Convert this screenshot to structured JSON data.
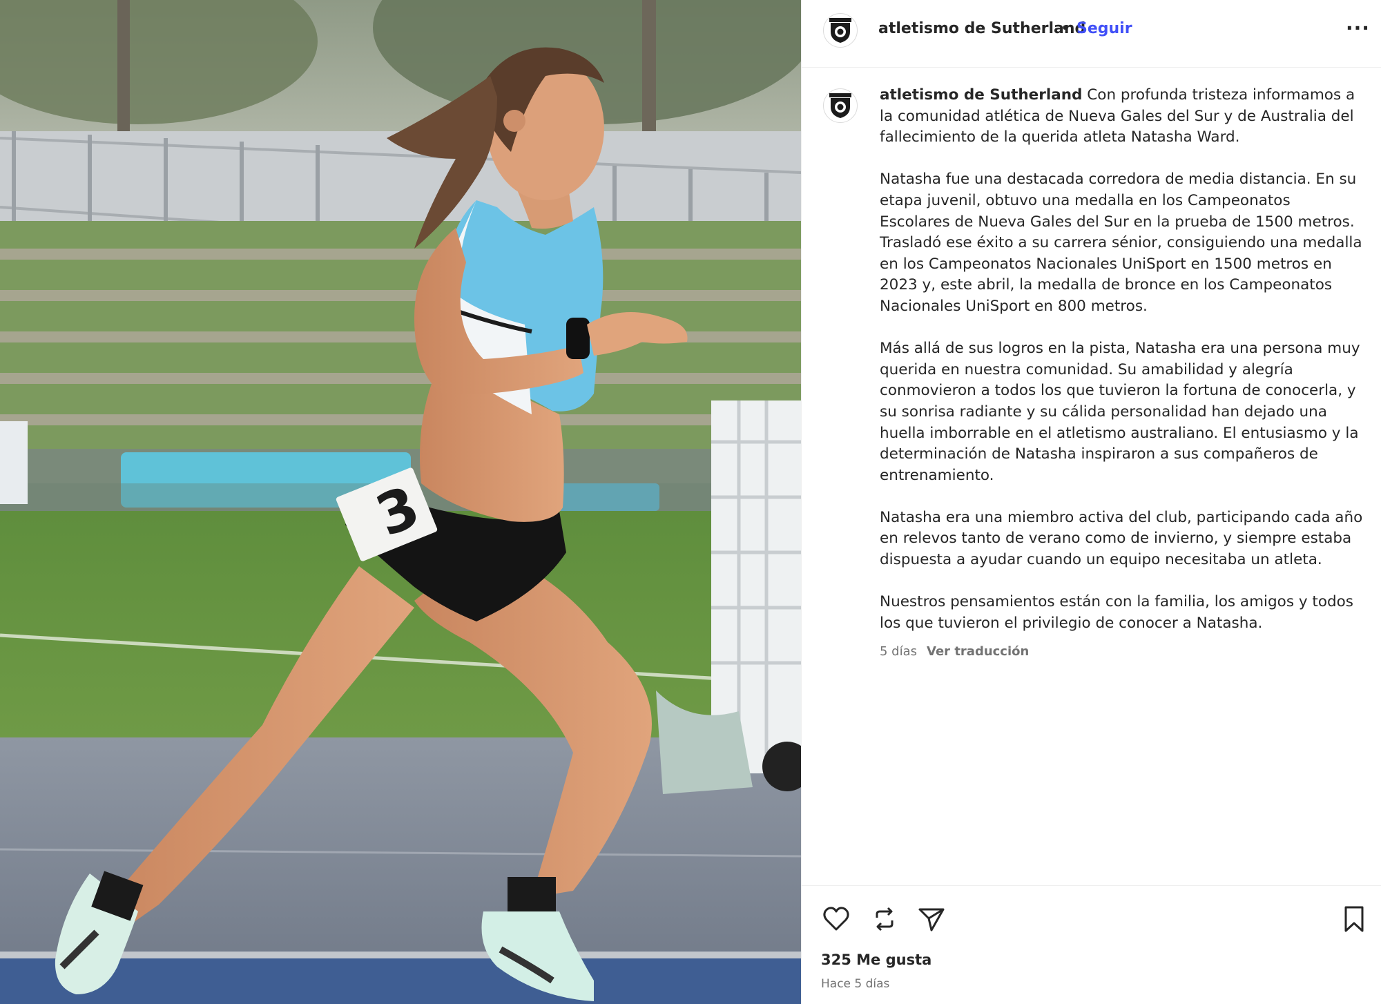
{
  "post": {
    "photo_alt": "Natasha Ward",
    "bib_number": "3"
  },
  "header": {
    "account_name": "atletismo de Sutherland",
    "separator": "•",
    "follow_label": "Seguir",
    "more_label": "···"
  },
  "caption": {
    "username": "atletismo de Sutherland",
    "paragraphs": [
      "Con profunda tristeza informamos a la comunidad atlética de Nueva Gales del Sur y de Australia del fallecimiento de la querida atleta Natasha Ward.",
      "Natasha fue una destacada corredora de media distancia. En su etapa juvenil, obtuvo una medalla en los Campeonatos Escolares de Nueva Gales del Sur en la prueba de 1500 metros. Trasladó ese éxito a su carrera sénior, consiguiendo una medalla en los Campeonatos Nacionales UniSport en 1500 metros en 2023 y, este abril, la medalla de bronce en los Campeonatos Nacionales UniSport en 800 metros.",
      "Más allá de sus logros en la pista, Natasha era una persona muy querida en nuestra comunidad. Su amabilidad y alegría conmovieron a todos los que tuvieron la fortuna de conocerla, y su sonrisa radiante y su cálida personalidad han dejado una huella imborrable en el atletismo australiano. El entusiasmo y la determinación de Natasha inspiraron a sus compañeros de entrenamiento.",
      "Natasha era una miembro activa del club, participando cada año en relevos tanto de verano como de invierno, y siempre estaba dispuesta a ayudar cuando un equipo necesitaba un atleta.",
      "Nuestros pensamientos están con la familia, los amigos y todos los que tuvieron el privilegio de conocer a Natasha."
    ],
    "age": "5 días",
    "translate_label": "Ver traducción"
  },
  "actions": {
    "icons": [
      "heart-icon",
      "repost-icon",
      "share-icon",
      "bookmark-icon"
    ],
    "likes_label": "325 Me gusta",
    "posted_label": "Hace 5 días"
  },
  "colors": {
    "link_blue": "#4150f7",
    "text": "#262626",
    "muted": "#737373",
    "divider": "#efefef",
    "track": "#4f5f8c",
    "field_green": "#5d8a3e",
    "singlet_blue": "#6cc3e6"
  }
}
